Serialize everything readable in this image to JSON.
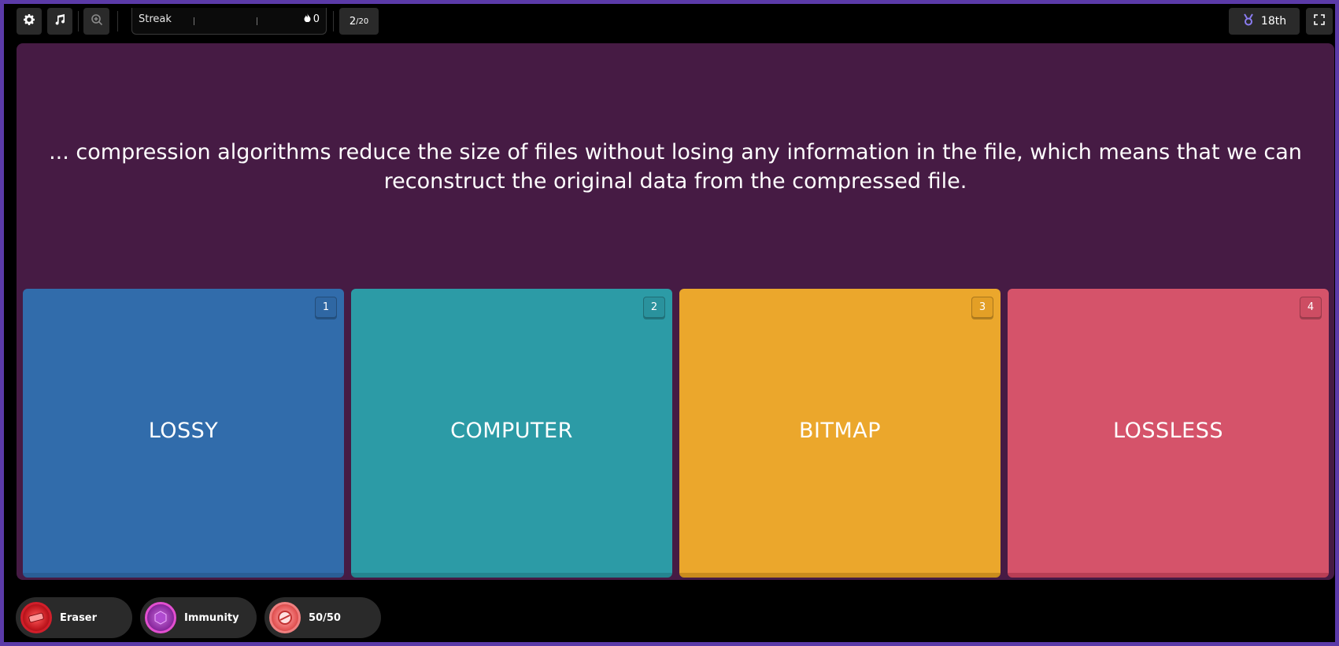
{
  "topbar": {
    "icons": [
      "gear-icon",
      "music-icon",
      "zoom-in-icon",
      "flame-icon",
      "medal-icon",
      "fullscreen-icon"
    ],
    "streak_label": "Streak",
    "streak_value": "0",
    "question_counter": {
      "current": "2",
      "total": "/20"
    },
    "rank": "18th"
  },
  "question": {
    "text": "... compression algorithms reduce the size of files without losing any information in the file, which means that we can reconstruct the original data from the compressed file."
  },
  "options": [
    {
      "number": "1",
      "label": "LOSSY",
      "color": "#316cab"
    },
    {
      "number": "2",
      "label": "COMPUTER",
      "color": "#2c9ba6"
    },
    {
      "number": "3",
      "label": "BITMAP",
      "color": "#eba72c"
    },
    {
      "number": "4",
      "label": "LOSSLESS",
      "color": "#d5536a"
    }
  ],
  "powerups": [
    {
      "label": "Eraser",
      "icon": "eraser-icon"
    },
    {
      "label": "Immunity",
      "icon": "immunity-icon"
    },
    {
      "label": "50/50",
      "icon": "fifty-fifty-icon"
    }
  ],
  "colors": {
    "frame": "#5b3aa8",
    "panel": "#461b44",
    "background": "#000000"
  }
}
